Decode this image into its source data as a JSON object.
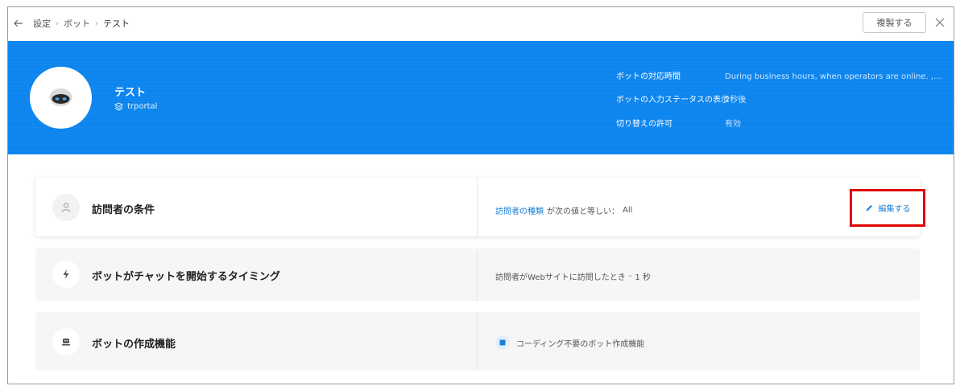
{
  "breadcrumb": {
    "items": [
      "設定",
      "ボット",
      "テスト"
    ]
  },
  "toolbar": {
    "duplicate_label": "複製する"
  },
  "bot": {
    "name": "テスト",
    "workspace": "trportal"
  },
  "info": {
    "rows": [
      {
        "label": "ボットの対応時間",
        "value": "During business hours, when operators are online. , 営業時..."
      },
      {
        "label": "ボットの入力ステータスの表示",
        "value": "2秒後"
      },
      {
        "label": "切り替えの許可",
        "value": "有効"
      }
    ]
  },
  "cards": {
    "visitor": {
      "title": "訪問者の条件",
      "desc_link": "訪問者の種類",
      "desc_text": "が次の値と等しい：",
      "desc_value": "All",
      "edit_label": "編集する"
    },
    "timing": {
      "title": "ボットがチャットを開始するタイミング",
      "desc_text": "訪問者がWebサイトに訪問したとき",
      "desc_sep": "-",
      "desc_value": "1 秒"
    },
    "builder": {
      "title": "ボットの作成機能",
      "desc_text": "コーディング不要のボット作成機能"
    }
  },
  "colors": {
    "hero": "#0b84ee",
    "link": "#1a7fd6",
    "highlight": "#e00000"
  },
  "icons": {
    "back": "arrow-left-icon",
    "close": "close-icon",
    "workspace": "stack-icon",
    "visitor": "user-icon",
    "timing": "lightning-icon",
    "builder": "robot-icon",
    "edit": "pencil-icon",
    "nocode": "cube-icon"
  }
}
